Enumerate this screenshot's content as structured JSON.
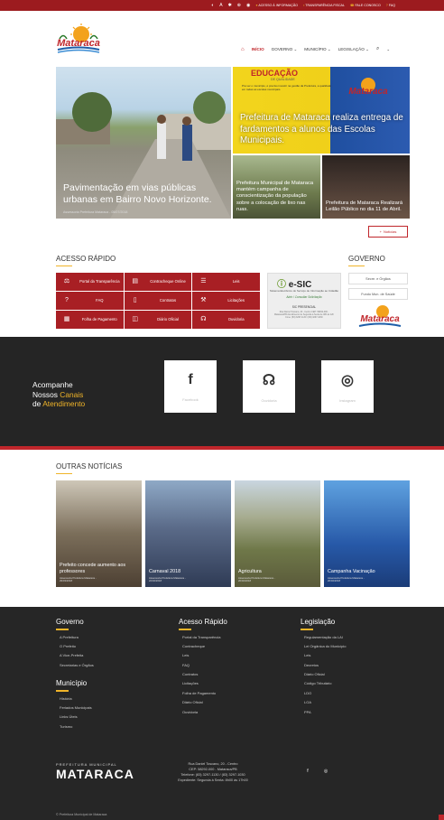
{
  "topbar": {
    "links": [
      {
        "label": "ACESSO À INFORMAÇÃO",
        "icon": "info-icon"
      },
      {
        "label": "TRANSPARÊNCIA FISCAL",
        "icon": "chart-icon"
      },
      {
        "label": "FALE CONOSCO",
        "icon": "phone-icon"
      },
      {
        "label": "FAQ",
        "icon": "question-icon"
      }
    ]
  },
  "header": {
    "logo_text": "Mataraca",
    "nav": {
      "home": "INÍCIO",
      "governo": "GOVERNO",
      "municipio": "MUNICÍPIO",
      "legislacao": "LEGISLAÇÃO"
    }
  },
  "hero": {
    "main": {
      "caption": "Pavimentação em vias públicas urbanas em Bairro Novo Horizonte.",
      "meta": "Assessoria Prefeitura Mataraca - 05/07/2018"
    },
    "top_right": {
      "banner_title": "EDUCAÇÃO",
      "banner_sub": "DE QUALIDADE",
      "banner_text": "Pra ver o município, é preciso investir na gestão da Prefeitura, a qualidade em todas as escolas municipais.",
      "caption": "Prefeitura de Mataraca realiza entrega de fardamentos a alunos das Escolas Municipais."
    },
    "small1": {
      "caption": "Prefeitura Municipal de Mataraca mantém campanha de conscientização da população sobre a colocação de lixo nas ruas."
    },
    "small2": {
      "caption": "Prefeitura de Mataraca Realizará Leilão Público no dia 11 de Abril."
    }
  },
  "noticias_button": "Notícias",
  "acesso": {
    "title": "ACESSO RÁPIDO",
    "items": [
      {
        "label": "Portal da Transparência",
        "icon": "scale-icon"
      },
      {
        "label": "Contracheque Online",
        "icon": "payslip-icon"
      },
      {
        "label": "Leis",
        "icon": "document-icon"
      },
      {
        "label": "FAQ",
        "icon": "question-icon"
      },
      {
        "label": "Contratos",
        "icon": "contract-icon"
      },
      {
        "label": "Licitações",
        "icon": "gavel-icon"
      },
      {
        "label": "Folha de Pagamento",
        "icon": "payroll-icon"
      },
      {
        "label": "Diário Oficial",
        "icon": "book-icon"
      },
      {
        "label": "Ouvidoria",
        "icon": "headset-icon"
      }
    ]
  },
  "esic": {
    "logo": "e-SIC",
    "sub": "Sistema Eletrônico do Serviço de Informação ao Cidadão",
    "link": "Abrir / Consultar Solicitação",
    "sic": "SIC PRESENCIAL",
    "sictxt": "Rua Darcel Toscano, 20 - Centro CEP: 58292-000 - Mataraca/PB Atendimento de Segunda à Sexta de 08h às 12h Fone: (83) 3297-1130 / (83) 3297-1030"
  },
  "governo": {
    "title": "GOVERNO",
    "items": [
      "Secre. e Órgãos",
      "Fundo Mun. de Saúde"
    ]
  },
  "social": {
    "head1": "Acompanhe",
    "head2a": "Nossos ",
    "head2b": "Canais",
    "head3a": "de ",
    "head3b": "Atendimento",
    "boxes": [
      {
        "label": "Facebook",
        "icon": "facebook-icon",
        "glyph": "f"
      },
      {
        "label": "Ouvidoria",
        "icon": "headphones-icon",
        "glyph": "☊"
      },
      {
        "label": "Instagram",
        "icon": "instagram-icon",
        "glyph": "◎"
      }
    ]
  },
  "outras": {
    "title": "OUTRAS NOTÍCIAS",
    "items": [
      {
        "caption": "Prefeito concede aumento aos professores",
        "meta1": "Assessoria Prefeitura Mataraca -",
        "meta2": "29/03/2018"
      },
      {
        "caption": "Carnaval 2018",
        "meta1": "Assessoria Prefeitura Mataraca -",
        "meta2": "22/02/2018"
      },
      {
        "caption": "Agricultura",
        "meta1": "Assessoria Prefeitura Mataraca -",
        "meta2": "20/02/2018"
      },
      {
        "caption": "Campanha Vacinação",
        "meta1": "Assessoria Prefeitura Mataraca -",
        "meta2": "20/02/2018"
      }
    ]
  },
  "footer": {
    "governo": {
      "title": "Governo",
      "items": [
        "A Prefeitura",
        "O Prefeito",
        "A Vice-Prefeita",
        "Secretarias e Órgãos"
      ]
    },
    "municipio": {
      "title": "Município",
      "items": [
        "História",
        "Feriados Municipais",
        "Links Úteis",
        "Turismo"
      ]
    },
    "acesso": {
      "title": "Acesso Rápido",
      "items": [
        "Portal da Transparência",
        "Contracheque",
        "Leis",
        "FAQ",
        "Contratos",
        "Licitações",
        "Folha de Pagamento",
        "Diário Oficial",
        "Ouvidoria"
      ]
    },
    "legislacao": {
      "title": "Legislação",
      "items": [
        "Regulamentação da LAI",
        "Lei Orgânica do Município",
        "Leis",
        "Decretos",
        "Diário Oficial",
        "Código Tributário",
        "LDO",
        "LOA",
        "PPA"
      ]
    },
    "logo_small": "PREFEITURA MUNICIPAL",
    "logo_big": "MATARACA",
    "address1": "Rua Daniel Toscano, 20 - Centro",
    "address2": "CEP: 58292-000 - Mataraca/PB",
    "address3": "Telefone: (83) 3297-1130 / (83) 3297-1030",
    "address4": "Expediente: Segunda à Sexta: 8h00 às 17h00",
    "copyright": "© Prefeitura Municipal de Mataraca"
  }
}
